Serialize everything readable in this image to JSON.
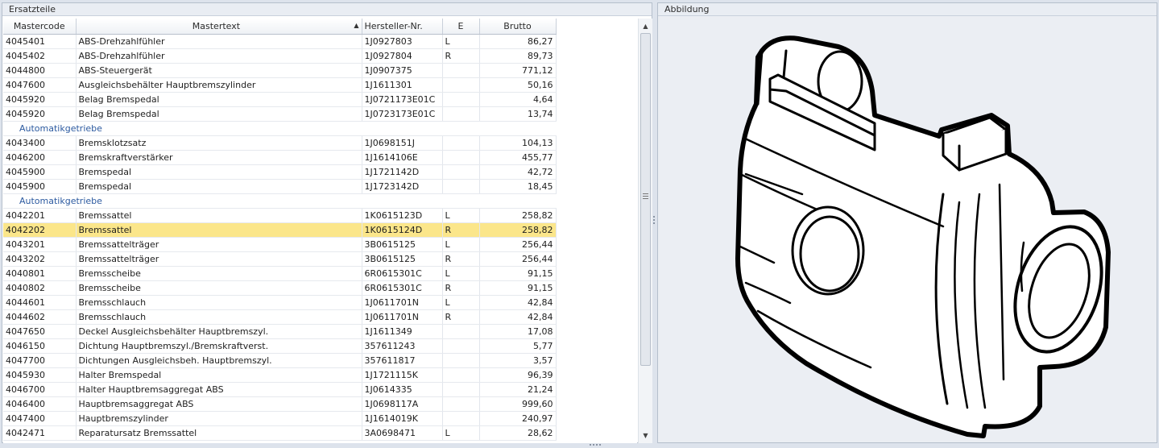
{
  "left_panel": {
    "title": "Ersatzteile"
  },
  "right_panel": {
    "title": "Abbildung",
    "image_icon": "brake-caliper-drawing-icon"
  },
  "table": {
    "columns": [
      "Mastercode",
      "Mastertext",
      "Hersteller-Nr.",
      "E",
      "Brutto"
    ],
    "sorted_column": "Mastertext",
    "rows": [
      {
        "code": "4045401",
        "text": "ABS-Drehzahlfühler",
        "nr": "1J0927803",
        "e": "L",
        "brutto": "86,27"
      },
      {
        "code": "4045402",
        "text": "ABS-Drehzahlfühler",
        "nr": "1J0927804",
        "e": "R",
        "brutto": "89,73"
      },
      {
        "code": "4044800",
        "text": "ABS-Steuergerät",
        "nr": "1J0907375",
        "e": "",
        "brutto": "771,12"
      },
      {
        "code": "4047600",
        "text": "Ausgleichsbehälter Hauptbremszylinder",
        "nr": "1J1611301",
        "e": "",
        "brutto": "50,16"
      },
      {
        "code": "4045920",
        "text": "Belag Bremspedal",
        "nr": "1J0721173E01C",
        "e": "",
        "brutto": "4,64"
      },
      {
        "code": "4045920",
        "text": "Belag Bremspedal",
        "nr": "1J0723173E01C",
        "e": "",
        "brutto": "13,74"
      },
      {
        "group": "Automatikgetriebe"
      },
      {
        "code": "4043400",
        "text": "Bremsklotzsatz",
        "nr": "1J0698151J",
        "e": "",
        "brutto": "104,13"
      },
      {
        "code": "4046200",
        "text": "Bremskraftverstärker",
        "nr": "1J1614106E",
        "e": "",
        "brutto": "455,77"
      },
      {
        "code": "4045900",
        "text": "Bremspedal",
        "nr": "1J1721142D",
        "e": "",
        "brutto": "42,72"
      },
      {
        "code": "4045900",
        "text": "Bremspedal",
        "nr": "1J1723142D",
        "e": "",
        "brutto": "18,45"
      },
      {
        "group": "Automatikgetriebe"
      },
      {
        "code": "4042201",
        "text": "Bremssattel",
        "nr": "1K0615123D",
        "e": "L",
        "brutto": "258,82"
      },
      {
        "code": "4042202",
        "text": "Bremssattel",
        "nr": "1K0615124D",
        "e": "R",
        "brutto": "258,82",
        "selected": true
      },
      {
        "code": "4043201",
        "text": "Bremssattelträger",
        "nr": "3B0615125",
        "e": "L",
        "brutto": "256,44"
      },
      {
        "code": "4043202",
        "text": "Bremssattelträger",
        "nr": "3B0615125",
        "e": "R",
        "brutto": "256,44"
      },
      {
        "code": "4040801",
        "text": "Bremsscheibe",
        "nr": "6R0615301C",
        "e": "L",
        "brutto": "91,15"
      },
      {
        "code": "4040802",
        "text": "Bremsscheibe",
        "nr": "6R0615301C",
        "e": "R",
        "brutto": "91,15"
      },
      {
        "code": "4044601",
        "text": "Bremsschlauch",
        "nr": "1J0611701N",
        "e": "L",
        "brutto": "42,84"
      },
      {
        "code": "4044602",
        "text": "Bremsschlauch",
        "nr": "1J0611701N",
        "e": "R",
        "brutto": "42,84"
      },
      {
        "code": "4047650",
        "text": "Deckel Ausgleichsbehälter Hauptbremszyl.",
        "nr": "1J1611349",
        "e": "",
        "brutto": "17,08"
      },
      {
        "code": "4046150",
        "text": "Dichtung Hauptbremszyl./Bremskraftverst.",
        "nr": "357611243",
        "e": "",
        "brutto": "5,77"
      },
      {
        "code": "4047700",
        "text": "Dichtungen Ausgleichsbeh. Hauptbremszyl.",
        "nr": "357611817",
        "e": "",
        "brutto": "3,57"
      },
      {
        "code": "4045930",
        "text": "Halter Bremspedal",
        "nr": "1J1721115K",
        "e": "",
        "brutto": "96,39"
      },
      {
        "code": "4046700",
        "text": "Halter Hauptbremsaggregat ABS",
        "nr": "1J0614335",
        "e": "",
        "brutto": "21,24"
      },
      {
        "code": "4046400",
        "text": "Hauptbremsaggregat ABS",
        "nr": "1J0698117A",
        "e": "",
        "brutto": "999,60"
      },
      {
        "code": "4047400",
        "text": "Hauptbremszylinder",
        "nr": "1J1614019K",
        "e": "",
        "brutto": "240,97"
      },
      {
        "code": "4042471",
        "text": "Reparatursatz Bremssattel",
        "nr": "3A0698471",
        "e": "L",
        "brutto": "28,62"
      }
    ]
  },
  "colors": {
    "selected_row": "#fbe68a",
    "group_text": "#2c5aa0",
    "panel_bg": "#dde3ec"
  }
}
